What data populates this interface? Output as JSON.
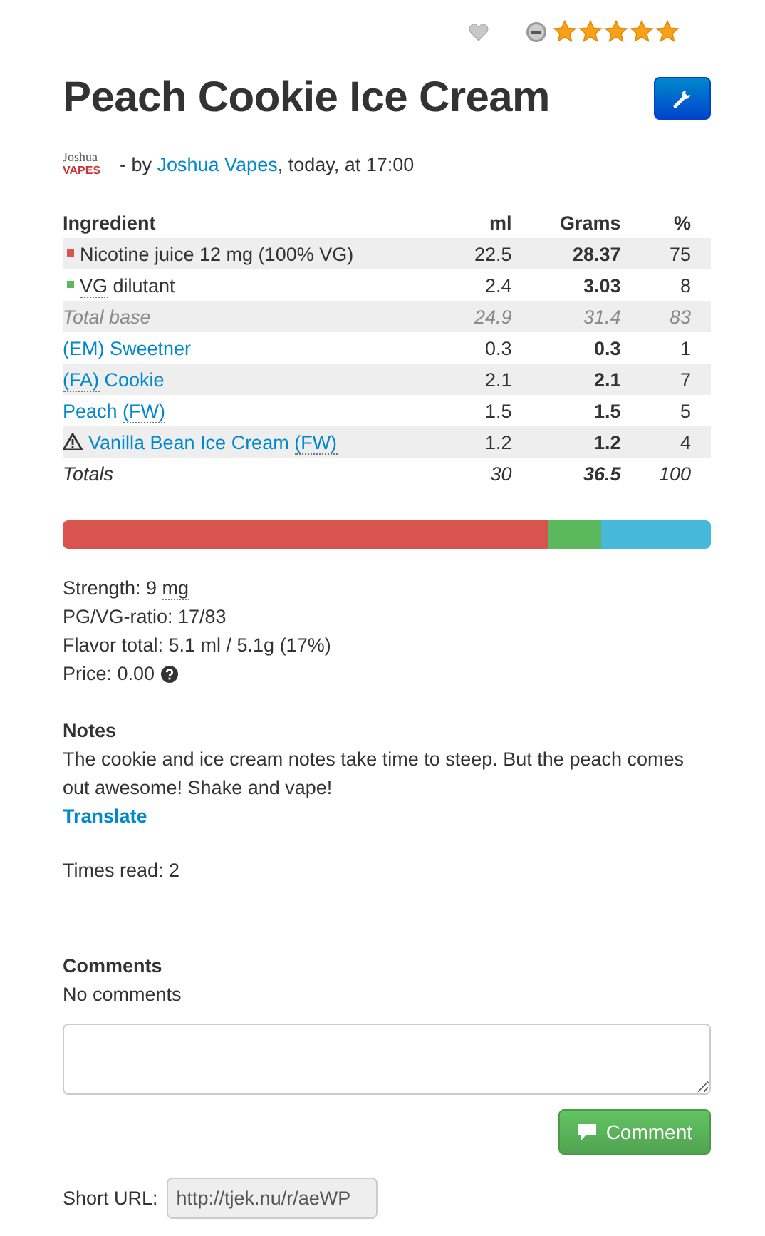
{
  "rating": {
    "favorite": false,
    "stars": 5
  },
  "title": "Peach Cookie Ice Cream",
  "author": {
    "logo": [
      "Joshua",
      "VAPES"
    ],
    "prefix": "- by ",
    "name": "Joshua Vapes",
    "suffix": ", today, at 17:00"
  },
  "table": {
    "columns": [
      "Ingredient",
      "ml",
      "Grams",
      "%"
    ],
    "rows": [
      {
        "kind": "base",
        "color": "#d9534f",
        "name": [
          {
            "text": "Nicotine juice 12 mg (100% VG)"
          }
        ],
        "ml": "22.5",
        "grams": "28.37",
        "percent": "75"
      },
      {
        "kind": "base",
        "color": "#5cb85c",
        "name": [
          {
            "text": "VG",
            "abbr": true
          },
          {
            "text": " dilutant"
          }
        ],
        "ml": "2.4",
        "grams": "3.03",
        "percent": "8"
      },
      {
        "kind": "subtotal",
        "name": [
          {
            "text": "Total base"
          }
        ],
        "ml": "24.9",
        "grams": "31.4",
        "percent": "83"
      },
      {
        "kind": "flavor",
        "name": [
          {
            "text": "(EM) Sweetner"
          }
        ],
        "ml": "0.3",
        "grams": "0.3",
        "percent": "1"
      },
      {
        "kind": "flavor",
        "name": [
          {
            "text": "(FA)",
            "abbr": true
          },
          {
            "text": " Cookie"
          }
        ],
        "ml": "2.1",
        "grams": "2.1",
        "percent": "7"
      },
      {
        "kind": "flavor",
        "name": [
          {
            "text": "Peach "
          },
          {
            "text": "(FW)",
            "abbr": true
          }
        ],
        "ml": "1.5",
        "grams": "1.5",
        "percent": "5"
      },
      {
        "kind": "warning",
        "name": [
          {
            "text": "Vanilla Bean Ice Cream "
          },
          {
            "text": "(FW)",
            "abbr": true
          }
        ],
        "ml": "1.2",
        "grams": "1.2",
        "percent": "4"
      },
      {
        "kind": "total",
        "name": [
          {
            "text": "Totals"
          }
        ],
        "ml": "30",
        "grams": "36.5",
        "percent": "100"
      }
    ]
  },
  "mix_bar": [
    {
      "color": "#d9534f"
    },
    {
      "color": "#5cb85c"
    },
    {
      "color": "#46b8da"
    }
  ],
  "stats": [
    {
      "parts": [
        {
          "text": "Strength: 9 "
        },
        {
          "text": "mg",
          "abbr": true
        }
      ]
    },
    {
      "parts": [
        {
          "text": "PG/VG-ratio: 17/83"
        }
      ]
    },
    {
      "parts": [
        {
          "text": "Flavor total: 5.1 ml / 5.1g (17%)"
        }
      ]
    },
    {
      "parts": [
        {
          "text": "Price: 0.00"
        }
      ],
      "help": true
    }
  ],
  "notes": {
    "heading": "Notes",
    "text": "The cookie and ice cream notes take time to steep. But the peach comes out awesome! Shake and vape!",
    "translate": "Translate"
  },
  "times_read": "Times read: 2",
  "comments": {
    "heading": "Comments",
    "empty": "No comments",
    "button": "Comment"
  },
  "short_url": {
    "label": "Short URL:",
    "value": "http://tjek.nu/r/aeWP"
  }
}
